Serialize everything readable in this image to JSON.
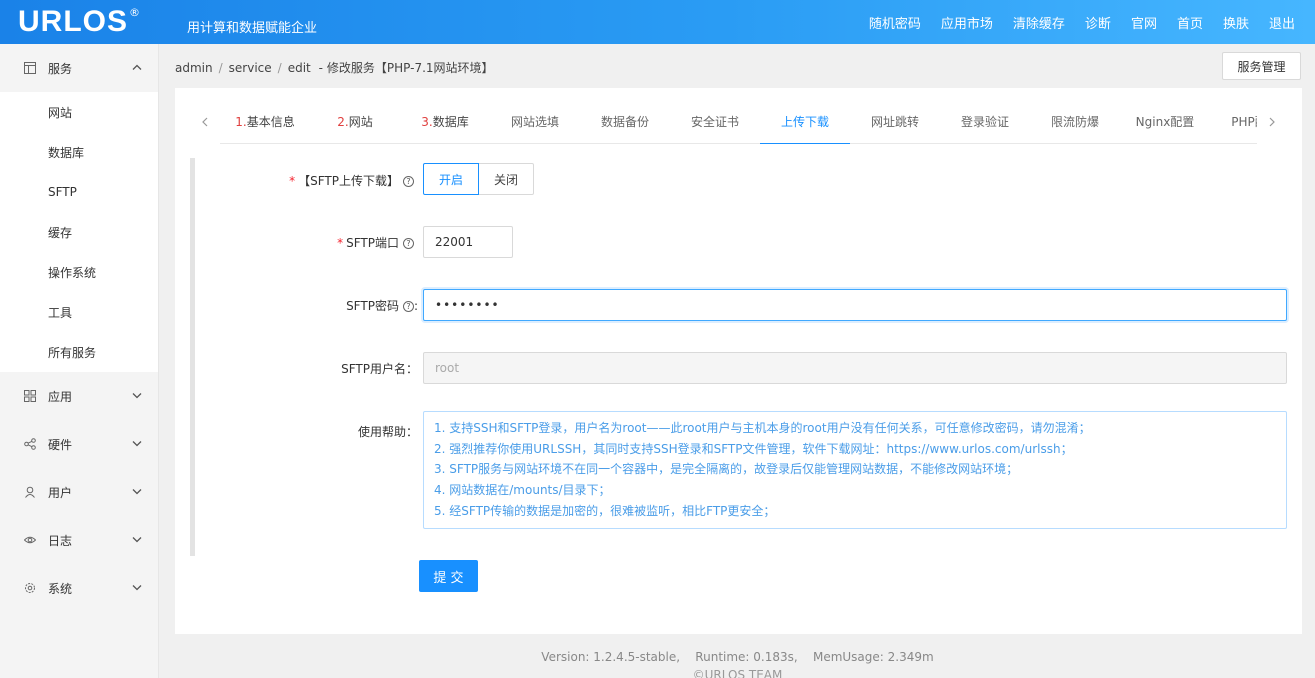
{
  "header": {
    "logo": "URLOS",
    "logo_mark": "®",
    "slogan": "用计算和数据赋能企业",
    "nav": [
      "随机密码",
      "应用市场",
      "清除缓存",
      "诊断",
      "官网",
      "首页",
      "换肤",
      "退出"
    ]
  },
  "sidebar": {
    "service": {
      "label": "服务",
      "expanded": true,
      "items": [
        "网站",
        "数据库",
        "SFTP",
        "缓存",
        "操作系统",
        "工具",
        "所有服务"
      ]
    },
    "groups": [
      {
        "label": "应用",
        "icon": "grid-icon"
      },
      {
        "label": "硬件",
        "icon": "share-icon"
      },
      {
        "label": "用户",
        "icon": "user-icon"
      },
      {
        "label": "日志",
        "icon": "eye-icon"
      },
      {
        "label": "系统",
        "icon": "gear-icon"
      }
    ]
  },
  "breadcrumb": {
    "items": [
      "admin",
      "service",
      "edit"
    ],
    "title": "修改服务【PHP-7.1网站环境】",
    "dash": "-"
  },
  "service_manage_button": "服务管理",
  "tabs": [
    {
      "num": "1.",
      "label": "基本信息"
    },
    {
      "num": "2.",
      "label": "网站"
    },
    {
      "num": "3.",
      "label": "数据库"
    },
    {
      "num": "",
      "label": "网站选填"
    },
    {
      "num": "",
      "label": "数据备份"
    },
    {
      "num": "",
      "label": "安全证书"
    },
    {
      "num": "",
      "label": "上传下载",
      "active": true
    },
    {
      "num": "",
      "label": "网址跳转"
    },
    {
      "num": "",
      "label": "登录验证"
    },
    {
      "num": "",
      "label": "限流防爆"
    },
    {
      "num": "",
      "label": "Nginx配置"
    },
    {
      "num": "",
      "label": "PHP配置"
    }
  ],
  "form": {
    "sftp_toggle": {
      "label": "【SFTP上传下载】",
      "on": "开启",
      "off": "关闭",
      "selected": "开启"
    },
    "sftp_port": {
      "label": "SFTP端口",
      "value": "22001"
    },
    "sftp_password": {
      "label": "SFTP密码",
      "value": "••••••••"
    },
    "sftp_username": {
      "label": "SFTP用户名：",
      "value": "root"
    },
    "help": {
      "label": "使用帮助：",
      "lines": [
        "1. 支持SSH和SFTP登录，用户名为root——此root用户与主机本身的root用户没有任何关系，可任意修改密码，请勿混淆；",
        "2. 强烈推荐你使用URLSSH，其同时支持SSH登录和SFTP文件管理，软件下载网址：https://www.urlos.com/urlssh；",
        "3. SFTP服务与网站环境不在同一个容器中，是完全隔离的，故登录后仅能管理网站数据，不能修改网站环境；",
        "4. 网站数据在/mounts/目录下；",
        "5. 经SFTP传输的数据是加密的，很难被监听，相比FTP更安全；"
      ]
    },
    "submit": "提 交"
  },
  "footer": {
    "version": "Version: 1.2.4.5-stable,    Runtime: 0.183s,    MemUsage: 2.349m",
    "copyright": "©URLOS TEAM"
  },
  "colors": {
    "primary": "#1890ff",
    "header": "#2a9cf4",
    "required": "#f5222d",
    "step_num": "#e0403f"
  }
}
